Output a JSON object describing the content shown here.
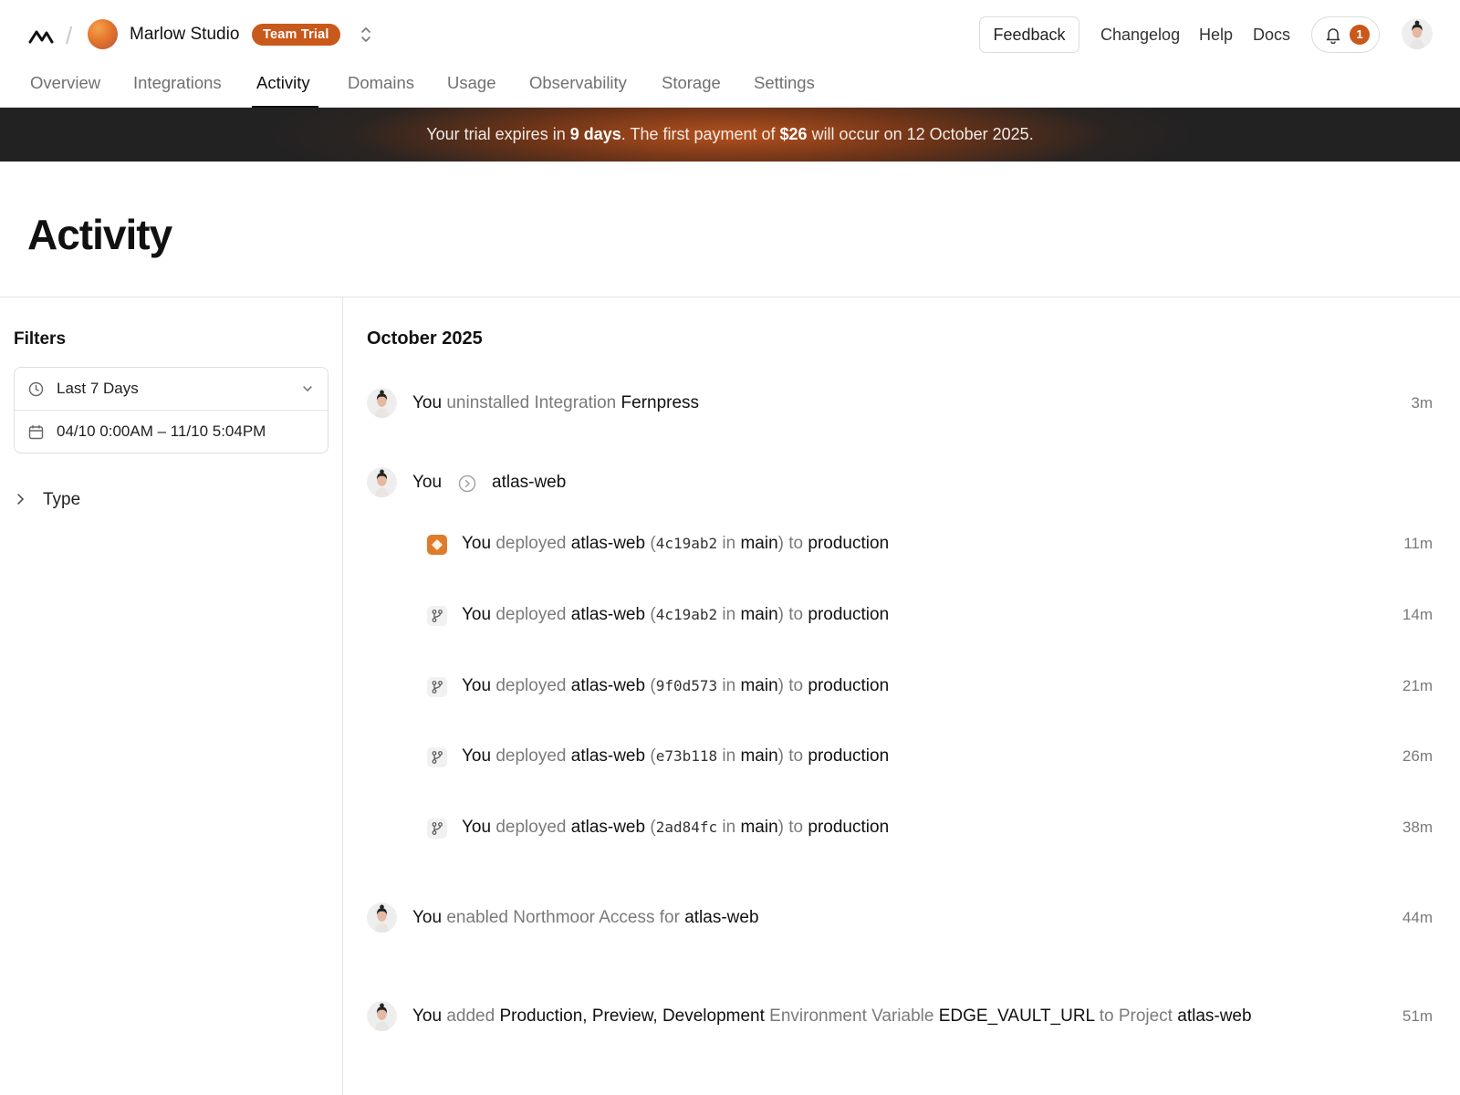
{
  "header": {
    "team_name": "Marlow Studio",
    "plan_badge": "Team Trial",
    "feedback": "Feedback",
    "links": [
      "Changelog",
      "Help",
      "Docs"
    ],
    "notifications_count": "1"
  },
  "tabs": [
    "Overview",
    "Integrations",
    "Activity",
    "Domains",
    "Usage",
    "Observability",
    "Storage",
    "Settings"
  ],
  "active_tab": "Activity",
  "banner": {
    "prefix": "Your trial expires in ",
    "days": "9 days",
    "middle": ". The first payment of ",
    "amount": "$26",
    "suffix": " will occur on 12 October 2025."
  },
  "page_title": "Activity",
  "filters": {
    "title": "Filters",
    "range": "Last 7 Days",
    "dates": "04/10 0:00AM – 11/10 5:04PM",
    "type_label": "Type"
  },
  "feed": {
    "month": "October 2025",
    "uninstall": {
      "you": "You",
      "action": " uninstalled Integration ",
      "target": "Fernpress",
      "time": "3m"
    },
    "group": {
      "you": "You",
      "project": "atlas-web"
    },
    "deploys": [
      {
        "you": "You",
        "verb": " deployed ",
        "project": "atlas-web",
        "open": " (",
        "commit": "4c19ab2",
        "in": " in ",
        "branch": "main",
        "close": ") to ",
        "env": "production",
        "time": "11m"
      },
      {
        "you": "You",
        "verb": " deployed ",
        "project": "atlas-web",
        "open": " (",
        "commit": "4c19ab2",
        "in": " in ",
        "branch": "main",
        "close": ") to ",
        "env": "production",
        "time": "14m"
      },
      {
        "you": "You",
        "verb": " deployed ",
        "project": "atlas-web",
        "open": " (",
        "commit": "9f0d573",
        "in": " in ",
        "branch": "main",
        "close": ") to ",
        "env": "production",
        "time": "21m"
      },
      {
        "you": "You",
        "verb": " deployed ",
        "project": "atlas-web",
        "open": " (",
        "commit": "e73b118",
        "in": " in ",
        "branch": "main",
        "close": ") to ",
        "env": "production",
        "time": "26m"
      },
      {
        "you": "You",
        "verb": " deployed ",
        "project": "atlas-web",
        "open": " (",
        "commit": "2ad84fc",
        "in": " in ",
        "branch": "main",
        "close": ") to ",
        "env": "production",
        "time": "38m"
      }
    ],
    "access": {
      "you": "You",
      "action": " enabled Northmoor Access for ",
      "target": "atlas-web",
      "time": "44m"
    },
    "envvar": {
      "you": "You",
      "added": " added ",
      "envs": "Production, Preview, Development",
      "mid": " Environment Variable ",
      "var": "EDGE_VAULT_URL",
      "to": " to Project ",
      "project": "atlas-web",
      "time": "51m"
    }
  },
  "colors": {
    "accent": "#c9581b",
    "banner_dark": "#222222",
    "muted": "#7a7a7a"
  }
}
